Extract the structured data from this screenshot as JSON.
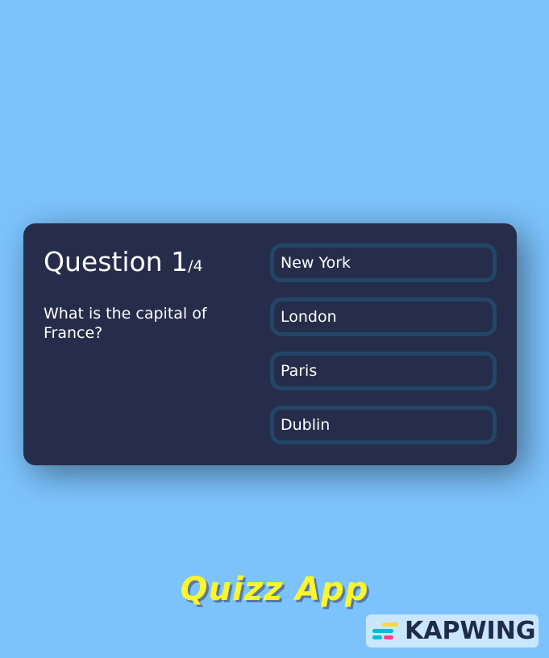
{
  "quiz": {
    "question_label": "Question 1",
    "question_total": "/4",
    "question_text": "What is the capital of France?",
    "answers": [
      {
        "label": "New York"
      },
      {
        "label": "London"
      },
      {
        "label": "Paris"
      },
      {
        "label": "Dublin"
      }
    ]
  },
  "app_title": "Quizz App",
  "watermark": {
    "text": "KAPWING",
    "logo_colors": [
      "#fdd835",
      "#00bcd4",
      "#ff4081"
    ]
  },
  "colors": {
    "background": "#7cc3fd",
    "card": "#252d4a",
    "answer_border": "#234668",
    "title": "#f9f52e"
  }
}
